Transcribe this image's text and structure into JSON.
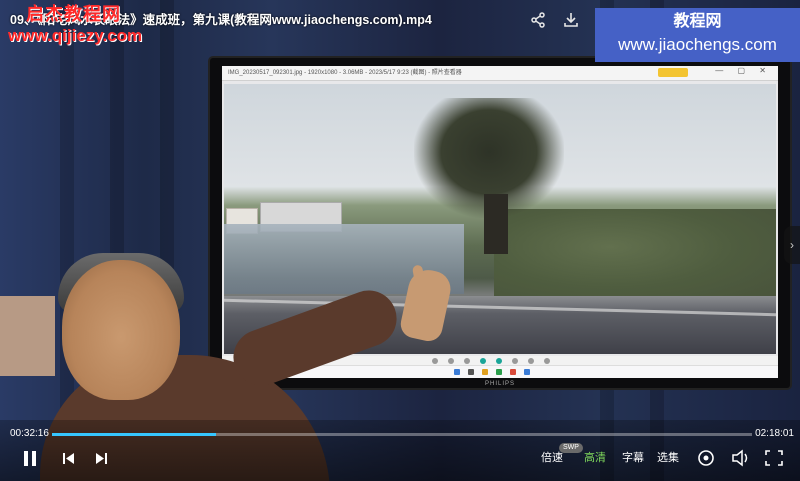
{
  "player": {
    "title": "09、《阳宅风水长眼法》速成班，第九课(教程网www.jiaochengs.com).mp4",
    "watermark_line1": "启杰教程网",
    "watermark_line2": "www.qijiezy.com",
    "brand_cn": "教程网",
    "brand_url": "www.jiaochengs.com",
    "time_current": "00:32:16",
    "time_total": "02:18:01",
    "progress_fraction": 0.2337,
    "speed_label": "倍速",
    "speed_badge": "SWP",
    "quality_label": "高清",
    "subtitle_label": "字幕",
    "episodes_label": "选集"
  },
  "tv": {
    "brand": "PHILIPS",
    "window_title": "IMG_20230517_092301.jpg - 1920x1080 - 3.06MB - 2023/5/17 9:23 (截图) - 照片查看器"
  },
  "icons": {
    "share": "share-icon",
    "download": "download-icon",
    "play_pause": "pause-icon",
    "prev": "previous-icon",
    "next": "next-icon",
    "danmaku": "target-icon",
    "volume": "volume-icon",
    "fullscreen": "fullscreen-icon",
    "side": "chevron-right-icon"
  },
  "colors": {
    "brand_bg": "#4561c6",
    "progress": "#36c6ff",
    "active_quality": "#7fd85c",
    "watermark": "#ff2a2a"
  }
}
